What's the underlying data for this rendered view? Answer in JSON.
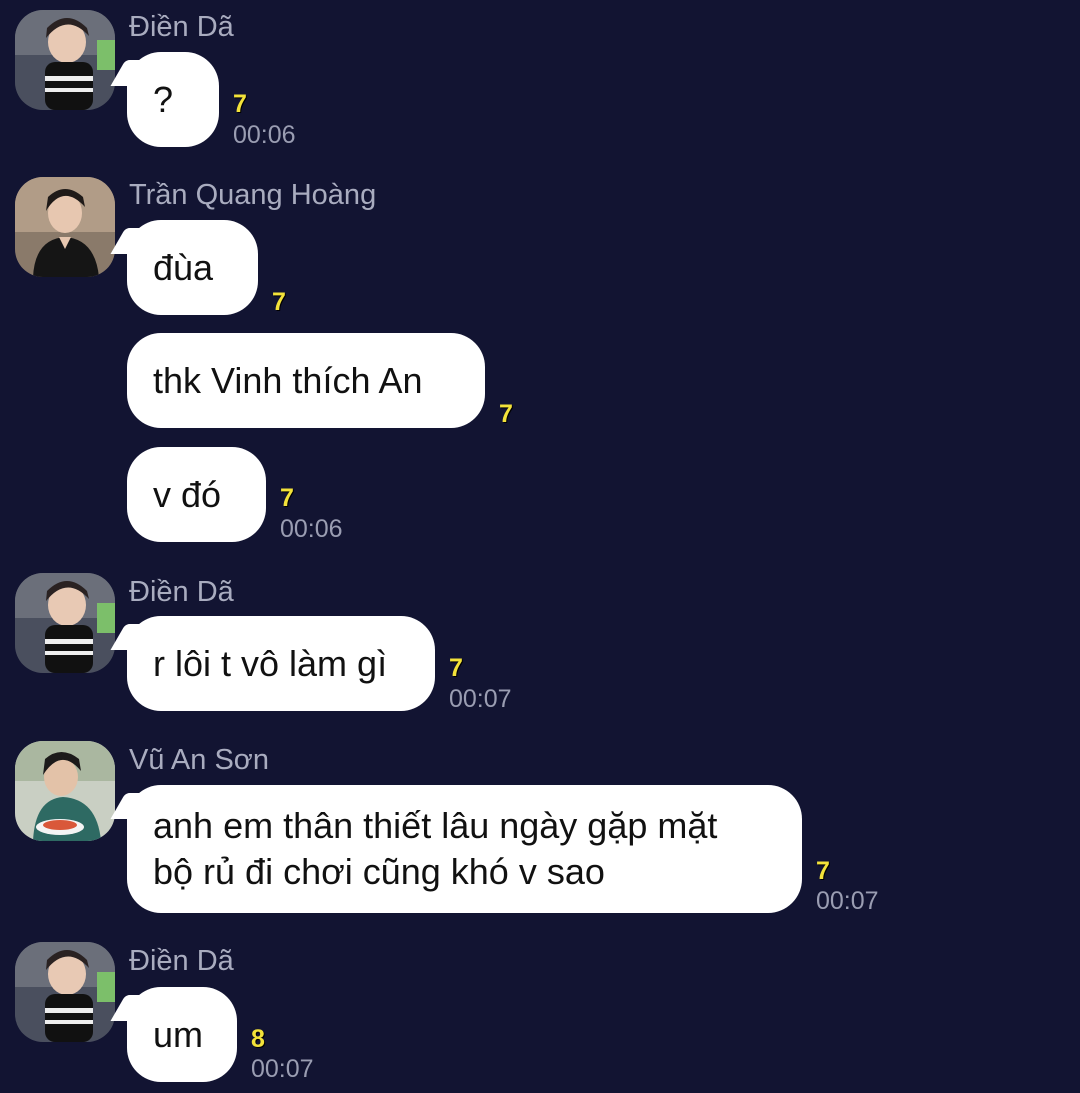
{
  "messages": [
    {
      "sender": "Điền Dã",
      "text": "?",
      "seen": "7",
      "time": "00:06"
    },
    {
      "sender": "Trần Quang Hoàng",
      "text": "đùa",
      "seen": "7"
    },
    {
      "text": "thk Vinh thích An",
      "seen": "7"
    },
    {
      "text": "v đó",
      "seen": "7",
      "time": "00:06"
    },
    {
      "sender": "Điền Dã",
      "text": "r lôi t vô làm gì",
      "seen": "7",
      "time": "00:07"
    },
    {
      "sender": "Vũ An Sơn",
      "text_line1": "anh em thân thiết lâu ngày gặp mặt",
      "text_line2": "bộ rủ đi chơi cũng khó v sao",
      "seen": "7",
      "time": "00:07"
    },
    {
      "sender": "Điền Dã",
      "text": "um",
      "seen": "8",
      "time": "00:07"
    }
  ],
  "icons": {
    "avatar_dien_da": "avatar-dien-da-icon",
    "avatar_tran_quang_hoang": "avatar-tran-quang-hoang-icon",
    "avatar_vu_an_son": "avatar-vu-an-son-icon"
  },
  "colors": {
    "background": "#121432",
    "bubble": "#ffffff",
    "seen_count": "#f3e23a",
    "timestamp": "#9a9db2"
  }
}
